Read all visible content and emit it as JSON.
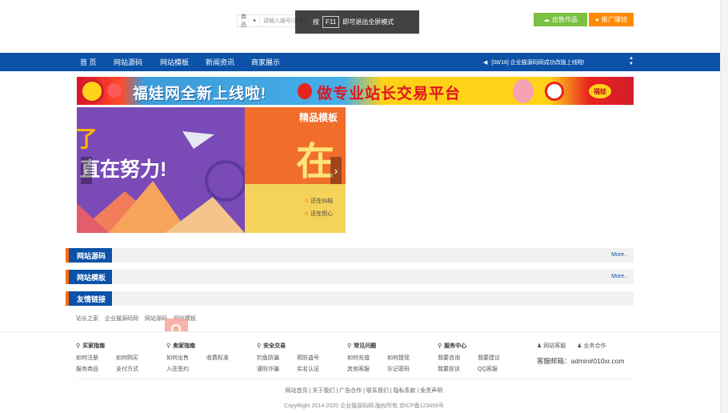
{
  "header": {
    "search_category": "商品",
    "search_placeholder": "请输入编号/关键字",
    "sell_button": "出售作品",
    "promo_button": "推广赚钱"
  },
  "fullscreen_tip": {
    "prefix": "按",
    "key": "F11",
    "suffix": "即可退出全屏模式"
  },
  "nav": {
    "items": [
      "首 页",
      "网站源码",
      "网站模板",
      "新闻资讯",
      "商家展示"
    ],
    "notice": "[08/18] 企业猫源码网成功改版上线啦!"
  },
  "banner": {
    "text_left": "福娃网全新上线啦!",
    "text_right": "做专业站长交易平台",
    "badge": "福娃"
  },
  "slider": {
    "left_char": "了",
    "left_text": "直在努力!",
    "right_title": "精品模板",
    "right_big": "在",
    "right_item1": "还在纠结",
    "right_item2": "还在担心"
  },
  "sections": [
    {
      "label": "网站源码",
      "more": "More.."
    },
    {
      "label": "网站模板",
      "more": "More.."
    },
    {
      "label": "友情链接",
      "more": ""
    }
  ],
  "friend_links": [
    "站长之家",
    "企业猫源码网",
    "网站源码",
    "网站模板"
  ],
  "footer": {
    "columns": [
      {
        "title": "买家指南",
        "rows": [
          [
            "如何注册",
            "如何购买"
          ],
          [
            "服务商品",
            "支付方式"
          ]
        ]
      },
      {
        "title": "卖家指南",
        "rows": [
          [
            "如何出售",
            "收费标准"
          ],
          [
            "入驻签约",
            ""
          ]
        ]
      },
      {
        "title": "安全交易",
        "rows": [
          [
            "钓鱼防骗",
            "预防盗号"
          ],
          [
            "谨防诈骗",
            "实名认证"
          ]
        ]
      },
      {
        "title": "常见问题",
        "rows": [
          [
            "如何充值",
            "如何提现"
          ],
          [
            "其他客服",
            "忘记密码"
          ]
        ]
      },
      {
        "title": "服务中心",
        "rows": [
          [
            "我要咨询",
            "我要建议"
          ],
          [
            "我要投诉",
            "QQ客服"
          ]
        ]
      }
    ],
    "contact_items": [
      "网站客服",
      "业务合作"
    ],
    "email": "客服邮箱：admin#010xr.com",
    "links": "网站首页 | 关于我们 | 广告合作 | 联系我们 | 隐私条款 | 免责声明",
    "copyright": "CopyRight 2014-2020 企业猫源码网 版权所有 京ICP备123456号"
  }
}
